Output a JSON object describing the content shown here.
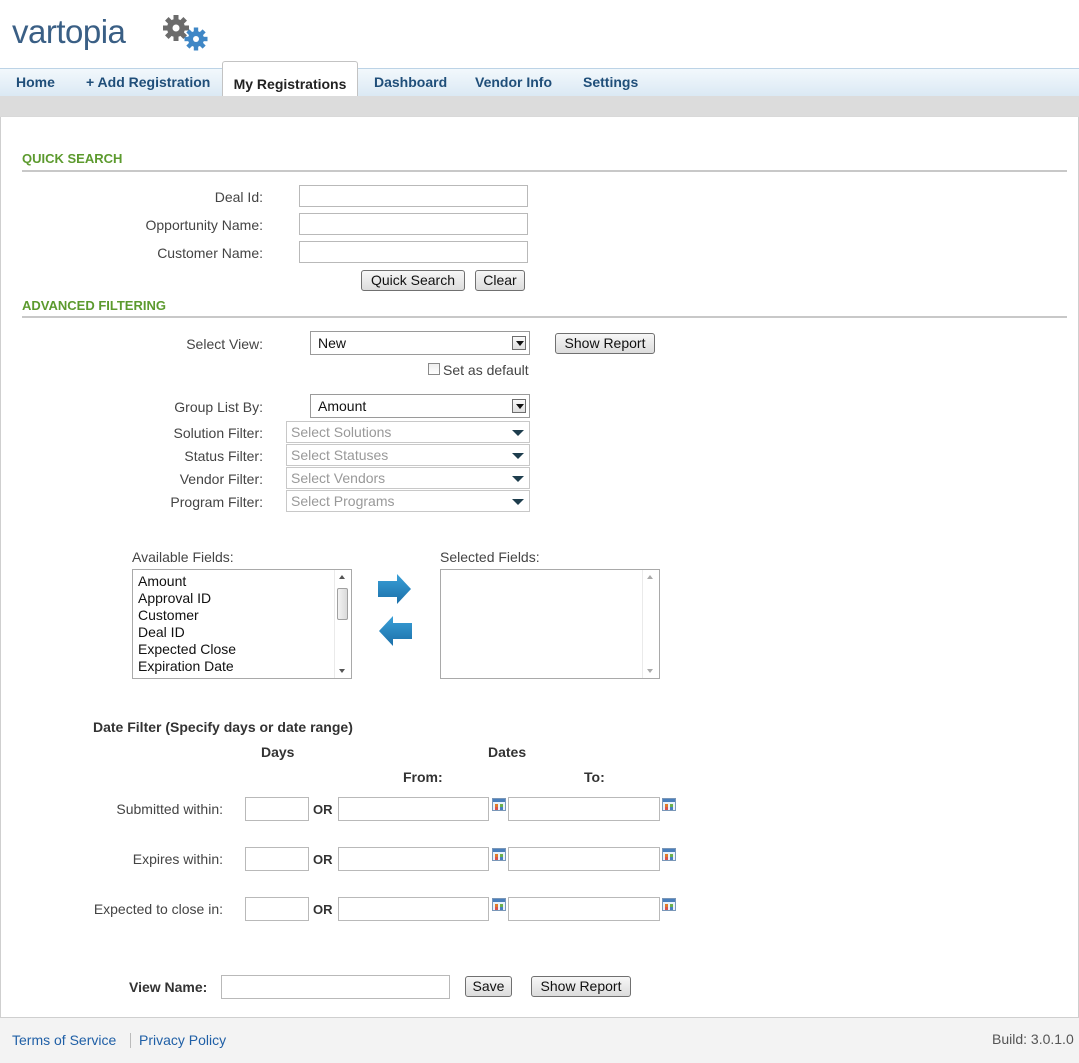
{
  "brand": {
    "logo_text": "vartopia"
  },
  "nav": {
    "tabs": [
      {
        "label": "Home"
      },
      {
        "label": "+ Add Registration"
      },
      {
        "label": "My Registrations"
      },
      {
        "label": "Dashboard"
      },
      {
        "label": "Vendor Info"
      },
      {
        "label": "Settings"
      }
    ],
    "active": "My Registrations"
  },
  "quick_search": {
    "title": "QUICK SEARCH",
    "deal_id_label": "Deal Id:",
    "opportunity_label": "Opportunity Name:",
    "customer_label": "Customer Name:",
    "deal_id_value": "",
    "opportunity_value": "",
    "customer_value": "",
    "search_button": "Quick Search",
    "clear_button": "Clear"
  },
  "advanced": {
    "title": "ADVANCED FILTERING",
    "select_view_label": "Select View:",
    "select_view_value": "New",
    "show_report_button": "Show Report",
    "set_default_label": "Set as default",
    "set_default_checked": false,
    "group_by_label": "Group List By:",
    "group_by_value": "Amount",
    "solution_label": "Solution Filter:",
    "solution_placeholder": "Select Solutions",
    "status_label": "Status Filter:",
    "status_placeholder": "Select Statuses",
    "vendor_label": "Vendor Filter:",
    "vendor_placeholder": "Select Vendors",
    "program_label": "Program Filter:",
    "program_placeholder": "Select Programs"
  },
  "fields": {
    "available_label": "Available Fields:",
    "selected_label": "Selected Fields:",
    "available": [
      "Amount",
      "Approval ID",
      "Customer",
      "Deal ID",
      "Expected Close",
      "Expiration Date"
    ],
    "selected": []
  },
  "date_filter": {
    "title": "Date Filter (Specify days or date range)",
    "days_header": "Days",
    "dates_header": "Dates",
    "from_header": "From:",
    "to_header": "To:",
    "or_label": "OR",
    "rows": [
      {
        "label": "Submitted within:"
      },
      {
        "label": "Expires within:"
      },
      {
        "label": "Expected to close in:"
      }
    ]
  },
  "view_save": {
    "label": "View Name:",
    "value": "",
    "save_button": "Save",
    "show_report_button": "Show Report"
  },
  "footer": {
    "terms": "Terms of Service",
    "privacy": "Privacy Policy",
    "build": "Build: 3.0.1.0"
  },
  "colors": {
    "brand_blue": "#3a5f85",
    "nav_text": "#1f4e79",
    "section_green": "#5c9a2e",
    "link_blue": "#1f5fa6"
  }
}
